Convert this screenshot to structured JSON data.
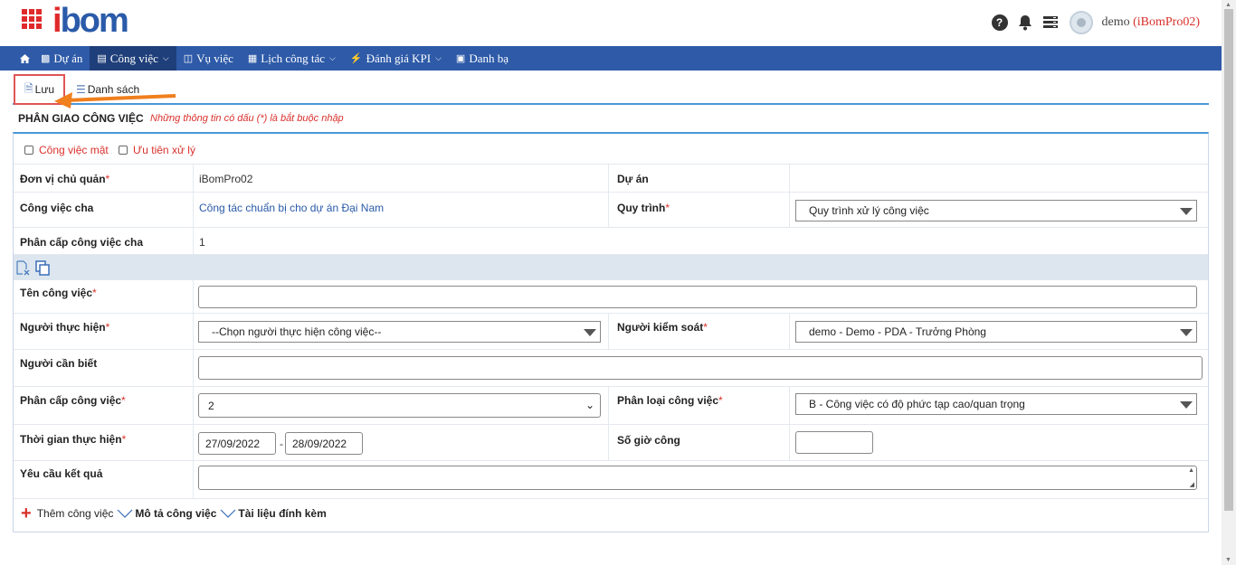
{
  "header": {
    "logo": "ibom",
    "user_name": "demo",
    "org": "(iBomPro02)"
  },
  "nav": {
    "items": [
      {
        "label": "Dự án",
        "icon": "building-icon"
      },
      {
        "label": "Công việc",
        "icon": "document-icon"
      },
      {
        "label": "Vụ việc",
        "icon": "book-icon"
      },
      {
        "label": "Lịch công tác",
        "icon": "calendar-icon"
      },
      {
        "label": "Đánh giá KPI",
        "icon": "bolt-icon"
      },
      {
        "label": "Danh bạ",
        "icon": "contacts-icon"
      }
    ]
  },
  "toolbar": {
    "save_label": "Lưu",
    "list_label": "Danh sách"
  },
  "section": {
    "title": "PHÂN GIAO CÔNG VIỆC",
    "note": "Những thông tin có dấu (*) là bắt buộc nhập"
  },
  "form": {
    "secret_label": "Công việc mật",
    "priority_label": "Ưu tiên xử lý",
    "unit_label": "Đơn vị chủ quản",
    "unit_value": "iBomPro02",
    "project_label": "Dự án",
    "parent_label": "Công việc cha",
    "parent_value": "Công tác chuẩn bị cho dự án Đại Nam",
    "process_label": "Quy trình",
    "process_value": "Quy trình xử lý công việc",
    "parent_level_label": "Phân cấp công việc cha",
    "parent_level_value": "1",
    "task_name_label": "Tên công việc",
    "assignee_label": "Người thực hiện",
    "assignee_value": "--Chọn người thực hiện công việc--",
    "supervisor_label": "Người kiểm soát",
    "supervisor_value": "demo - Demo - PDA - Trưởng Phòng",
    "watchers_label": "Người cần biết",
    "level_label": "Phân cấp công việc",
    "level_value": "2",
    "category_label": "Phân loại công việc",
    "category_value": "B - Công việc có độ phức tạp cao/quan trọng",
    "time_label": "Thời gian thực hiện",
    "start_date": "27/09/2022",
    "date_sep": "-",
    "end_date": "28/09/2022",
    "hours_label": "Số giờ công",
    "result_label": "Yêu cầu kết quả",
    "required_mark": "*"
  },
  "footer": {
    "add_task": "Thêm công việc",
    "description": "Mô tả công việc",
    "attachments": "Tài liệu đính kèm"
  },
  "colors": {
    "nav_bg": "#2e5aa8",
    "accent": "#4a97d8",
    "required": "#d9302b"
  }
}
